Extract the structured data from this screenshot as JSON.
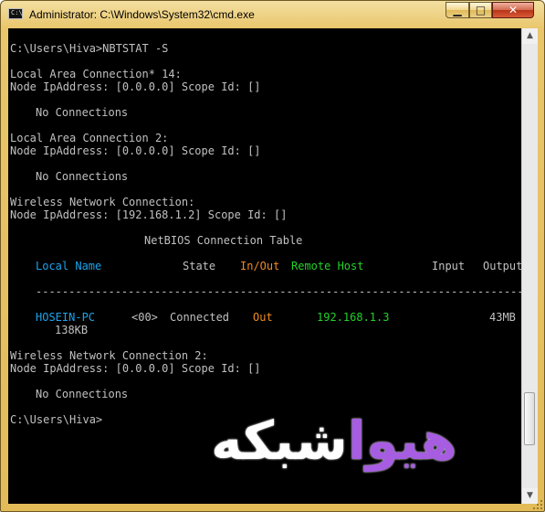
{
  "window": {
    "title": "Administrator: C:\\Windows\\System32\\cmd.exe",
    "icon_label": "C:\\",
    "controls": {
      "minimize": "▁",
      "maximize": "□",
      "close": "✕"
    }
  },
  "console": {
    "prompt_cmd": "C:\\Users\\Hiva>NBTSTAT -S",
    "adapter1": {
      "name": "Local Area Connection* 14:",
      "node": "Node IpAddress: [0.0.0.0] Scope Id: []",
      "status": "No Connections"
    },
    "adapter2": {
      "name": "Local Area Connection 2:",
      "node": "Node IpAddress: [0.0.0.0] Scope Id: []",
      "status": "No Connections"
    },
    "adapter3": {
      "name": "Wireless Network Connection:",
      "node": "Node IpAddress: [192.168.1.2] Scope Id: []"
    },
    "table": {
      "title": "NetBIOS Connection Table",
      "headers": {
        "local_name": "Local Name",
        "state": "State",
        "in_out": "In/Out",
        "remote_host": "Remote Host",
        "input": "Input",
        "output": "Output"
      },
      "separator": "--------------------------------------------------------------------------------",
      "rows": [
        {
          "local_name": "HOSEIN-PC",
          "suffix": "<00>",
          "state": "Connected",
          "in_out": "Out",
          "remote_host": "192.168.1.3",
          "input": "43MB",
          "output": "138KB"
        }
      ]
    },
    "adapter4": {
      "name": "Wireless Network Connection 2:",
      "node": "Node IpAddress: [0.0.0.0] Scope Id: []",
      "status": "No Connections"
    },
    "prompt_end": "C:\\Users\\Hiva>"
  },
  "scrollbar": {
    "up": "▲",
    "down": "▼"
  },
  "watermark": {
    "part_a": "هیوا",
    "part_b": "شبکه"
  }
}
